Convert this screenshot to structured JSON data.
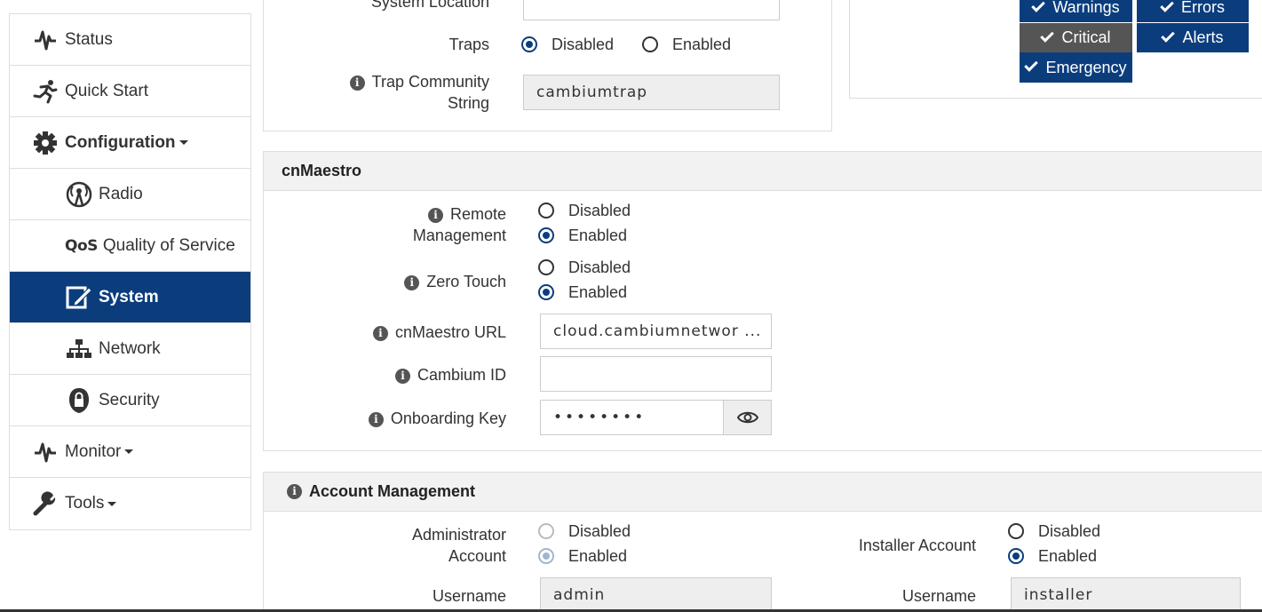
{
  "sidebar": {
    "items": [
      {
        "label": "Status",
        "icon": "pulse-icon"
      },
      {
        "label": "Quick Start",
        "icon": "running-icon"
      },
      {
        "label": "Configuration",
        "icon": "gear-icon"
      },
      {
        "label": "Radio",
        "icon": "radio-tower-icon"
      },
      {
        "label": "Quality of Service",
        "icon": "qos-icon",
        "prefix": "QoS"
      },
      {
        "label": "System",
        "icon": "edit-icon"
      },
      {
        "label": "Network",
        "icon": "sitemap-icon"
      },
      {
        "label": "Security",
        "icon": "lock-icon"
      },
      {
        "label": "Monitor",
        "icon": "pulse-icon"
      },
      {
        "label": "Tools",
        "icon": "wrench-icon"
      }
    ],
    "active_color": "#0b3d7d"
  },
  "snmp": {
    "system_location_label": "System Location",
    "traps_label": "Traps",
    "traps_options": [
      "Disabled",
      "Enabled"
    ],
    "traps_selected": "Disabled",
    "trap_community_label_1": "Trap Community",
    "trap_community_label_2": "String",
    "trap_community_value": "cambiumtrap"
  },
  "syslog": {
    "levels": [
      {
        "label": "Warnings",
        "checked": true
      },
      {
        "label": "Errors",
        "checked": true
      },
      {
        "label": "Critical",
        "checked": true
      },
      {
        "label": "Alerts",
        "checked": true
      },
      {
        "label": "Emergency",
        "checked": true
      }
    ]
  },
  "cnmaestro": {
    "title": "cnMaestro",
    "remote_label_1": "Remote",
    "remote_label_2": "Management",
    "remote_options": [
      "Disabled",
      "Enabled"
    ],
    "remote_selected": "Enabled",
    "zero_touch_label": "Zero Touch",
    "zero_touch_options": [
      "Disabled",
      "Enabled"
    ],
    "zero_touch_selected": "Enabled",
    "url_label": "cnMaestro URL",
    "url_value": "cloud.cambiumnetwor ...",
    "cambium_id_label": "Cambium ID",
    "cambium_id_value": "",
    "onboarding_key_label": "Onboarding Key",
    "onboarding_key_value": "••••••••"
  },
  "account": {
    "title": "Account Management",
    "admin_label_1": "Administrator",
    "admin_label_2": "Account",
    "admin_options": [
      "Disabled",
      "Enabled"
    ],
    "admin_selected": "Enabled",
    "installer_label": "Installer Account",
    "installer_options": [
      "Disabled",
      "Enabled"
    ],
    "installer_selected": "Enabled",
    "username_label": "Username",
    "admin_username": "admin",
    "installer_username": "installer"
  }
}
